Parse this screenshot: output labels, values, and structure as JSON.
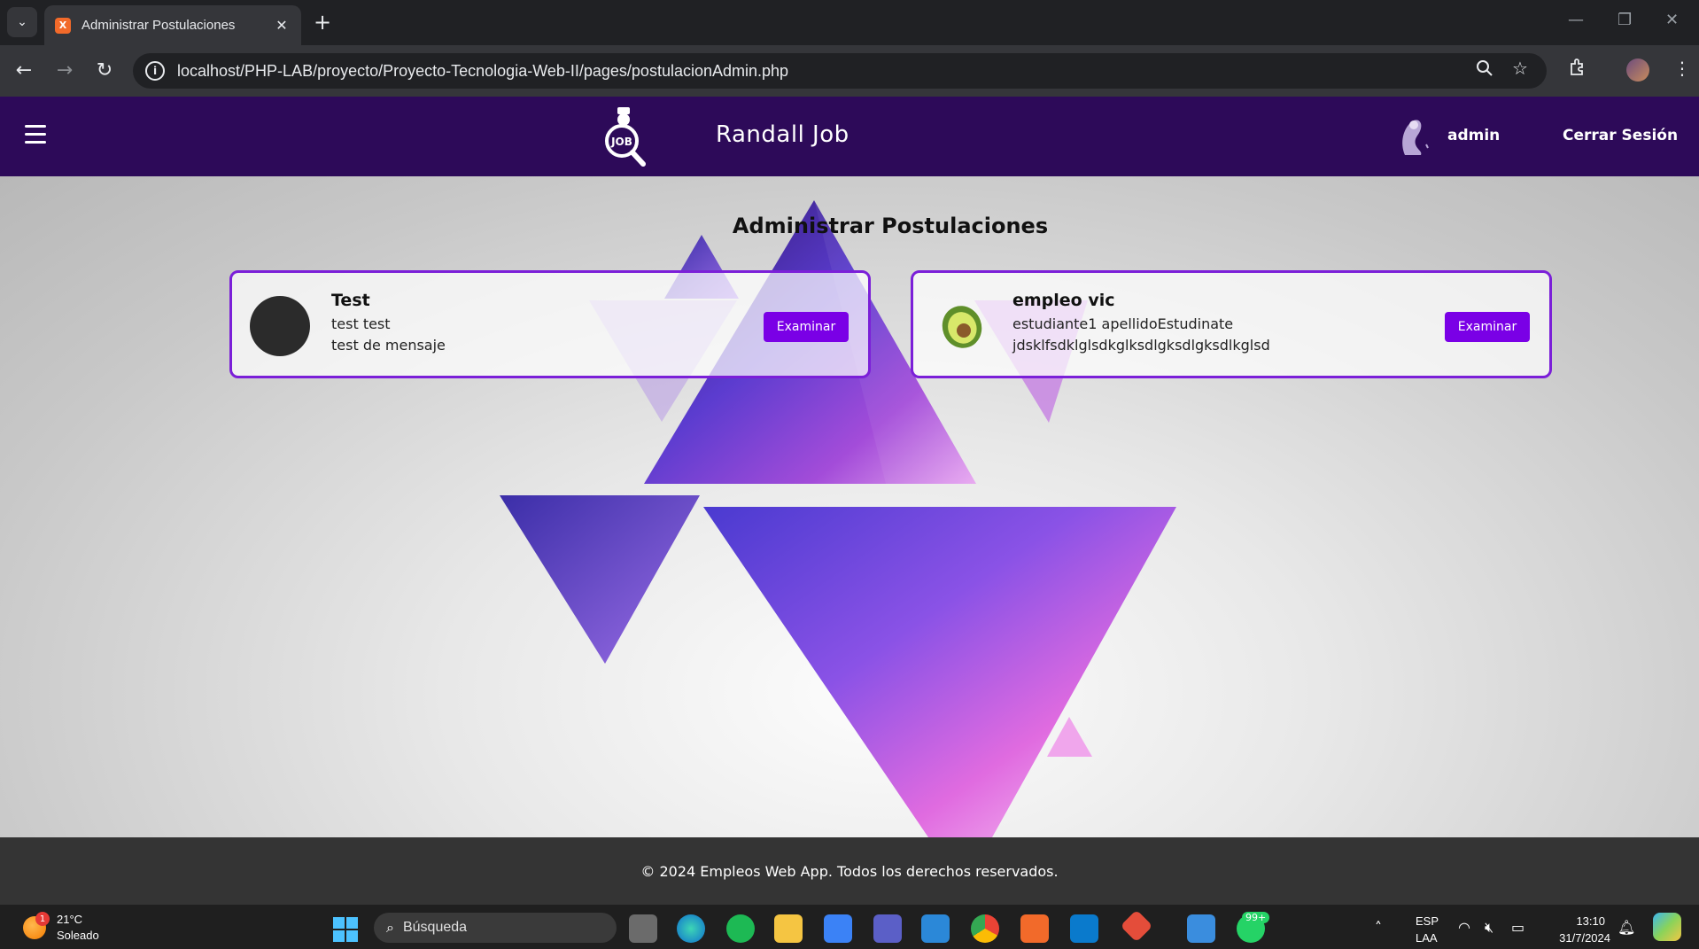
{
  "browser": {
    "tab_title": "Administrar Postulaciones",
    "tab_favicon_text": "X",
    "url": "localhost/PHP-LAB/proyecto/Proyecto-Tecnologia-Web-II/pages/postulacionAdmin.php"
  },
  "header": {
    "brand": "Randall Job",
    "logo_text": "JOB",
    "user": "admin",
    "logout": "Cerrar Sesión"
  },
  "page": {
    "title": "Administrar Postulaciones"
  },
  "postulaciones": [
    {
      "title": "Test",
      "line1": "test test",
      "line2": "test de mensaje",
      "button": "Examinar",
      "avatar": "dark-circle-avatar"
    },
    {
      "title": "empleo vic",
      "line1": "estudiante1 apellidoEstudinate",
      "line2": "jdsklfsdklglsdkglksdlgksdlgksdlkglsd",
      "button": "Examinar",
      "avatar": "avocado-avatar"
    }
  ],
  "footer": {
    "text": "© 2024 Empleos Web App. Todos los derechos reservados."
  },
  "taskbar": {
    "weather_temp": "21°C",
    "weather_desc": "Soleado",
    "weather_badge": "1",
    "search_placeholder": "Búsqueda",
    "whatsapp_badge": "99+",
    "lang_top": "ESP",
    "lang_bottom": "LAA",
    "time": "13:10",
    "date": "31/7/2024"
  },
  "colors": {
    "header_bg": "#2d0a59",
    "accent": "#7a00e6",
    "footer_bg": "#343434"
  }
}
